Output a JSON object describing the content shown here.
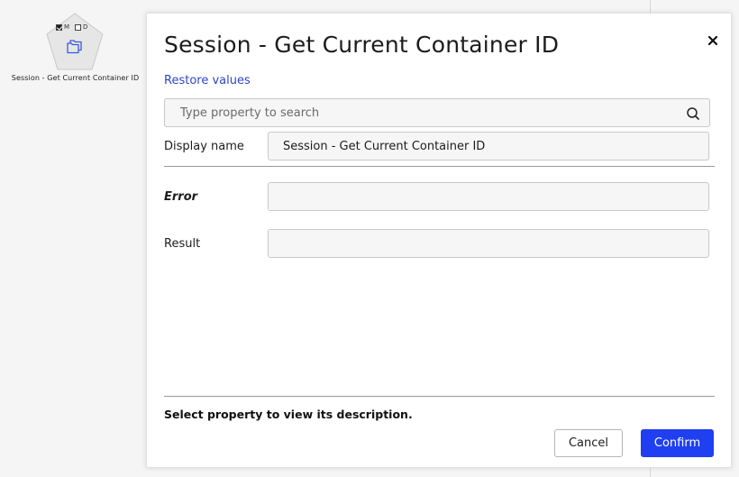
{
  "canvas": {
    "node": {
      "label": "Session - Get Current Container ID",
      "flag_m": {
        "label": "M",
        "checked": true
      },
      "flag_d": {
        "label": "D",
        "checked": false
      },
      "icon": "folder-copy-icon"
    }
  },
  "dialog": {
    "title": "Session - Get Current Container ID",
    "restore_label": "Restore values",
    "search": {
      "placeholder": "Type property to search",
      "value": ""
    },
    "properties": [
      {
        "label": "Display name",
        "value": "Session - Get Current Container ID",
        "emphasis": false
      },
      {
        "label": "Error",
        "value": "",
        "emphasis": true
      },
      {
        "label": "Result",
        "value": "",
        "emphasis": false
      }
    ],
    "description": "Select property to view its description.",
    "cancel_label": "Cancel",
    "confirm_label": "Confirm"
  },
  "colors": {
    "accent": "#1f3ff0",
    "link": "#2d47c7"
  }
}
